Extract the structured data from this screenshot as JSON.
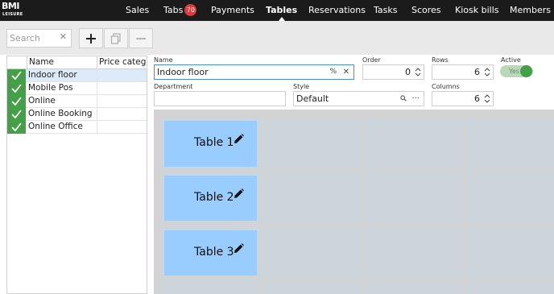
{
  "brand": {
    "line1": "BMI",
    "line2": "LEISURE"
  },
  "nav": {
    "sales": "Sales",
    "tabs": "Tabs",
    "tabs_badge": "70",
    "payments": "Payments",
    "tables": "Tables",
    "reservations": "Reservations",
    "tasks": "Tasks",
    "scores": "Scores",
    "kiosk_bills": "Kiosk bills",
    "members": "Members",
    "active": "Tables"
  },
  "toolbar": {
    "search_placeholder": "Search",
    "search_value": ""
  },
  "list": {
    "headers": {
      "name": "Name",
      "price_category": "Price category"
    },
    "rows": [
      {
        "name": "Indoor floor",
        "checked": true,
        "selected": true
      },
      {
        "name": "Mobile Pos",
        "checked": true
      },
      {
        "name": "Online",
        "checked": true
      },
      {
        "name": "Online Booking",
        "checked": true
      },
      {
        "name": "Online Office",
        "checked": true
      }
    ]
  },
  "form": {
    "name_label": "Name",
    "name_value": "Indoor floor",
    "order_label": "Order",
    "order_value": "0",
    "rows_label": "Rows",
    "rows_value": "6",
    "active_label": "Active",
    "active_value": "Yes",
    "department_label": "Department",
    "department_value": "",
    "style_label": "Style",
    "style_value": "Default",
    "columns_label": "Columns",
    "columns_value": "6"
  },
  "tables": [
    {
      "name": "Table 1"
    },
    {
      "name": "Table 2"
    },
    {
      "name": "Table 3"
    }
  ],
  "colors": {
    "accent_green": "#43a047",
    "table_card": "#99ccff",
    "badge": "#e0393e",
    "topbar": "#1b1b1b"
  }
}
